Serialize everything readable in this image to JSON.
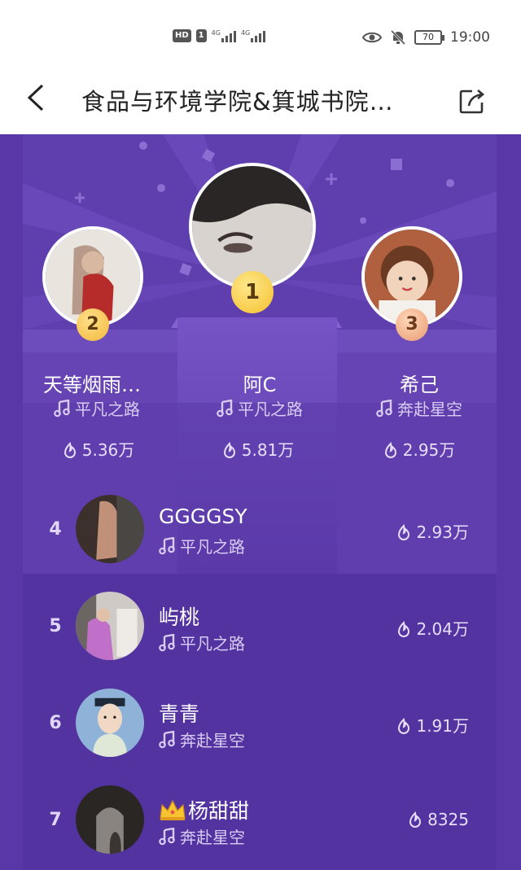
{
  "status_bar": {
    "hd_label": "HD",
    "sim_label": "1",
    "net1": "4G",
    "net2": "4G",
    "battery": "70",
    "time": "19:00"
  },
  "title_bar": {
    "title": "食品与环境学院&箕城书院…"
  },
  "podium": [
    {
      "rank": "1",
      "name": "阿C",
      "song": "平凡之路",
      "score": "5.81万"
    },
    {
      "rank": "2",
      "name": "天等烟雨…",
      "song": "平凡之路",
      "score": "5.36万"
    },
    {
      "rank": "3",
      "name": "希己",
      "song": "奔赴星空",
      "score": "2.95万"
    }
  ],
  "list": [
    {
      "rank": "4",
      "name": "GGGGSY",
      "song": "平凡之路",
      "score": "2.93万"
    },
    {
      "rank": "5",
      "name": "屿桃",
      "song": "平凡之路",
      "score": "2.04万"
    },
    {
      "rank": "6",
      "name": "青青",
      "song": "奔赴星空",
      "score": "1.91万"
    },
    {
      "rank": "7",
      "name": "杨甜甜",
      "song": "奔赴星空",
      "score": "8325"
    }
  ],
  "colors": {
    "panel": "#5233a0",
    "podium_light": "#7a58c4",
    "gold": "#f4c02f",
    "bronze": "#e89a72"
  }
}
